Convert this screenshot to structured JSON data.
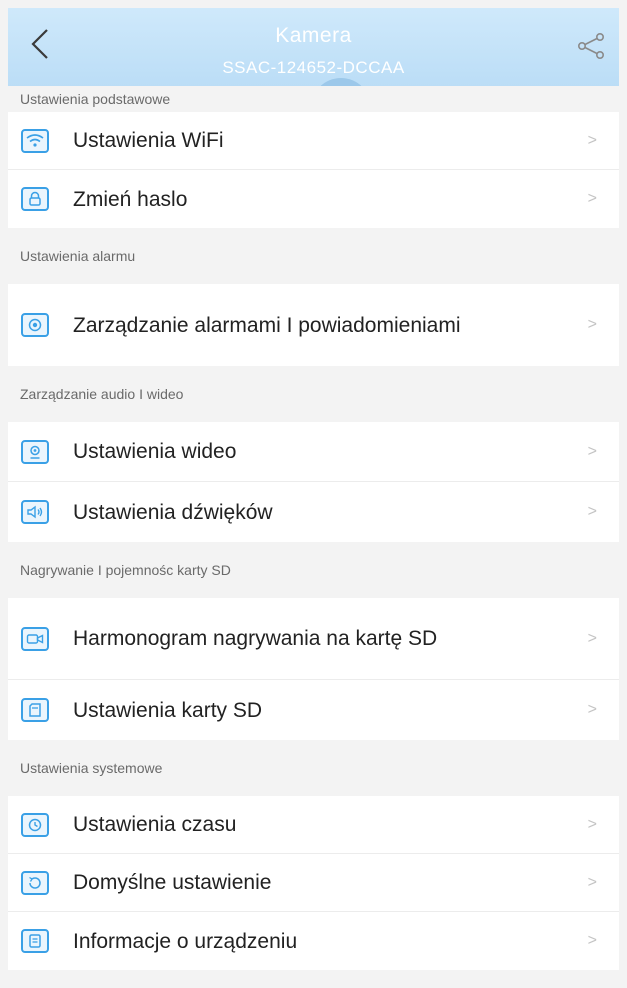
{
  "header": {
    "title": "Kamera",
    "subtitle": "SSAC-124652-DCCAA",
    "back_icon": "chevron-left-icon",
    "share_icon": "share-icon",
    "colors": {
      "gradient_top": "#cfe9fb",
      "gradient_bottom": "#b9dcf6",
      "accent": "#3aa0e6"
    }
  },
  "sections": [
    {
      "title": "Ustawienia podstawowe",
      "items": [
        {
          "label": "Ustawienia WiFi",
          "icon": "wifi-icon"
        },
        {
          "label": "Zmień haslo",
          "icon": "lock-icon"
        }
      ]
    },
    {
      "title": "Ustawienia alarmu",
      "items": [
        {
          "label": "Zarządzanie alarmami I powiadomieniami",
          "icon": "alarm-icon"
        }
      ]
    },
    {
      "title": "Zarządzanie audio I wideo",
      "items": [
        {
          "label": "Ustawienia wideo",
          "icon": "video-camera-icon"
        },
        {
          "label": "Ustawienia dźwięków",
          "icon": "speaker-icon"
        }
      ]
    },
    {
      "title": "Nagrywanie I pojemnośc karty SD",
      "items": [
        {
          "label": "Harmonogram nagrywania na kartę SD",
          "icon": "recording-icon"
        },
        {
          "label": "Ustawienia karty SD",
          "icon": "sd-card-icon"
        }
      ]
    },
    {
      "title": "Ustawienia systemowe",
      "items": [
        {
          "label": "Ustawienia czasu",
          "icon": "clock-icon"
        },
        {
          "label": "Domyślne ustawienie",
          "icon": "reset-icon"
        },
        {
          "label": "Informacje o urządzeniu",
          "icon": "device-info-icon"
        }
      ]
    }
  ]
}
